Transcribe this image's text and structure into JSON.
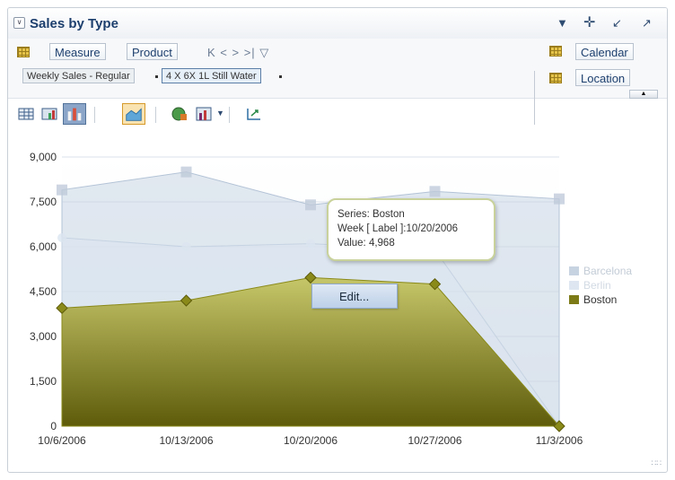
{
  "panel": {
    "title": "Sales by Type",
    "icons": [
      "chevron-down-icon",
      "move-icon",
      "minimize-icon",
      "maximize-icon"
    ]
  },
  "edge": {
    "row_chips": [
      "Measure",
      "Product"
    ],
    "nav_label": "K < > >| ▽",
    "slices": [
      "Weekly Sales - Regular",
      "4 X 6X 1L Still Water"
    ],
    "right_chips": [
      "Calendar",
      "Location"
    ]
  },
  "toolbar": {
    "icons": [
      "table-icon",
      "table-chart-icon",
      "bar-chart-icon",
      "area-chart-icon",
      "map-icon",
      "chart-type-icon",
      "dropdown-icon",
      "swap-axes-icon"
    ]
  },
  "tooltip": {
    "series": "Series: Boston",
    "week": "Week [ Label ]:10/20/2006",
    "value": "Value: 4,968"
  },
  "context_menu": {
    "edit": "Edit..."
  },
  "legend": [
    {
      "name": "Barcelona",
      "color": "#c7d3e1"
    },
    {
      "name": "Berlin",
      "color": "#dde6f1"
    },
    {
      "name": "Boston",
      "color": "#7c7a16"
    }
  ],
  "colors": {
    "title": "#1d3f6e",
    "boston_top": "#c6c66a",
    "boston_bottom": "#5e5c0a",
    "marker": "#8a8a1a"
  },
  "chart_data": {
    "type": "area",
    "x": [
      "10/6/2006",
      "10/13/2006",
      "10/20/2006",
      "10/27/2006",
      "11/3/2006"
    ],
    "ylim": [
      0,
      9000
    ],
    "yticks": [
      0,
      1500,
      3000,
      4500,
      6000,
      7500,
      9000
    ],
    "ytick_labels": [
      "0",
      "1,500",
      "3,000",
      "4,500",
      "6,000",
      "7,500",
      "9,000"
    ],
    "series": [
      {
        "name": "Barcelona",
        "values": [
          7900,
          8500,
          7400,
          7850,
          7600
        ]
      },
      {
        "name": "Berlin",
        "values": [
          6300,
          6000,
          6100,
          5900,
          0
        ]
      },
      {
        "name": "Boston",
        "values": [
          3950,
          4200,
          4968,
          4750,
          0
        ]
      }
    ],
    "legend": "right",
    "grid": true
  }
}
